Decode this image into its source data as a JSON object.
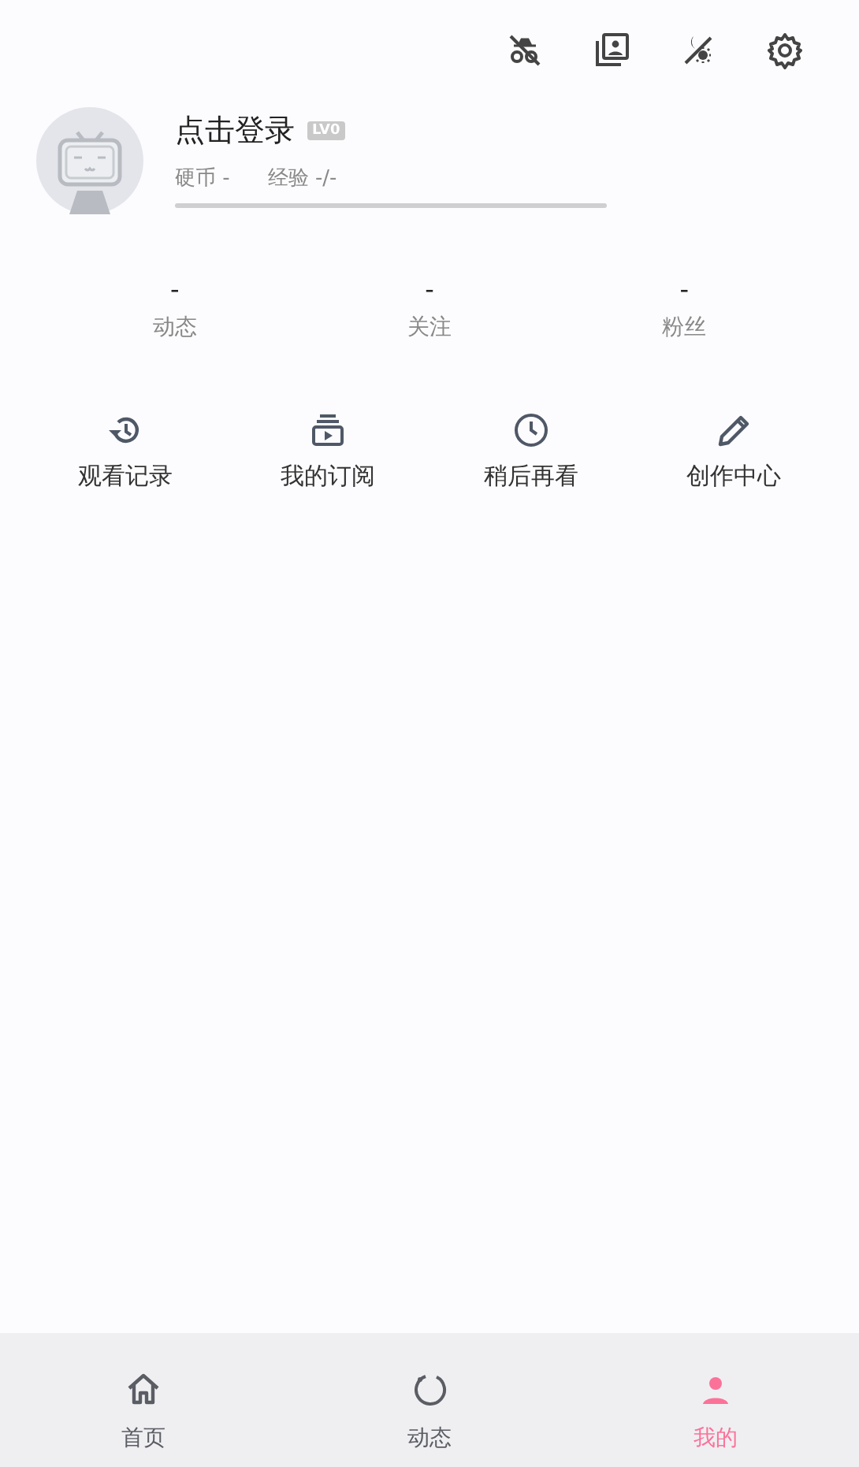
{
  "toolbar": {
    "icons": [
      {
        "kind": "incognito"
      },
      {
        "kind": "gallery"
      },
      {
        "kind": "theme"
      },
      {
        "kind": "settings"
      }
    ]
  },
  "profile": {
    "name": "点击登录",
    "level_badge": "LV0",
    "coins": "硬币 -",
    "exp": "经验 -/-"
  },
  "stats": [
    {
      "value": "-",
      "label": "动态"
    },
    {
      "value": "-",
      "label": "关注"
    },
    {
      "value": "-",
      "label": "粉丝"
    }
  ],
  "shortcuts": [
    {
      "kind": "history",
      "label": "观看记录"
    },
    {
      "kind": "subscription",
      "label": "我的订阅"
    },
    {
      "kind": "later",
      "label": "稍后再看"
    },
    {
      "kind": "create",
      "label": "创作中心"
    }
  ],
  "bottom_nav": [
    {
      "kind": "home",
      "label": "首页",
      "selected": false
    },
    {
      "kind": "dynamic",
      "label": "动态",
      "selected": false
    },
    {
      "kind": "mine",
      "label": "我的",
      "selected": true
    }
  ]
}
